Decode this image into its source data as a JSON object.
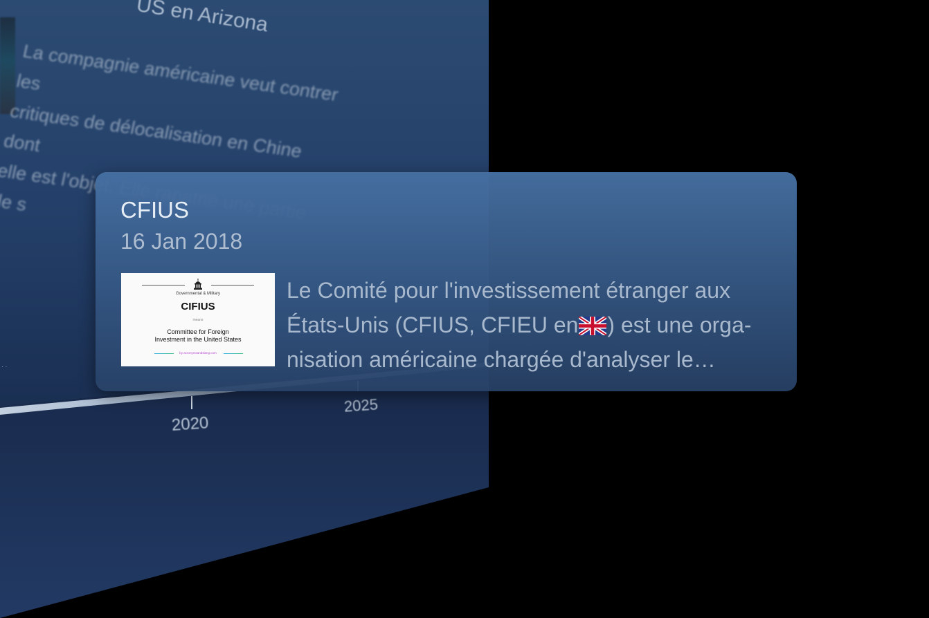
{
  "background_panel": {
    "headline_fragment": "US en Arizona",
    "body_fragment": [
      "La compagnie américaine veut contrer les",
      "critiques de délocalisation en Chine dont",
      "elle est l'objet. Elle rapatrie une partie de s"
    ],
    "timeline_ticks": [
      "2020",
      "2025"
    ]
  },
  "card": {
    "title": "CFIUS",
    "date": "16 Jan 2018",
    "thumbnail": {
      "category": "Governmental & Military",
      "acronym": "CIFIUS",
      "means_label": "means",
      "meaning_line1": "Committee for Foreign",
      "meaning_line2": "Investment in the United States",
      "credit": "by acronymsandslang.com",
      "icon": "capitol-building-icon"
    },
    "description": {
      "line1": "Le Comité pour l'investissement étranger aux",
      "line2_before_flag": "États-Unis (CFIUS, CFIEU en",
      "line2_after_flag": ") est une orga-",
      "line3": "nisation américaine chargée d'analyser le…",
      "flag_icon": "uk-flag-icon"
    }
  },
  "colors": {
    "background": "#000000",
    "panel_top": "#2e4a70",
    "panel_bottom": "#1a2a46",
    "card_top": "#4670a2",
    "card_bottom": "#284268",
    "title_text": "#e8eef6",
    "secondary_text": "#aebdd0"
  }
}
